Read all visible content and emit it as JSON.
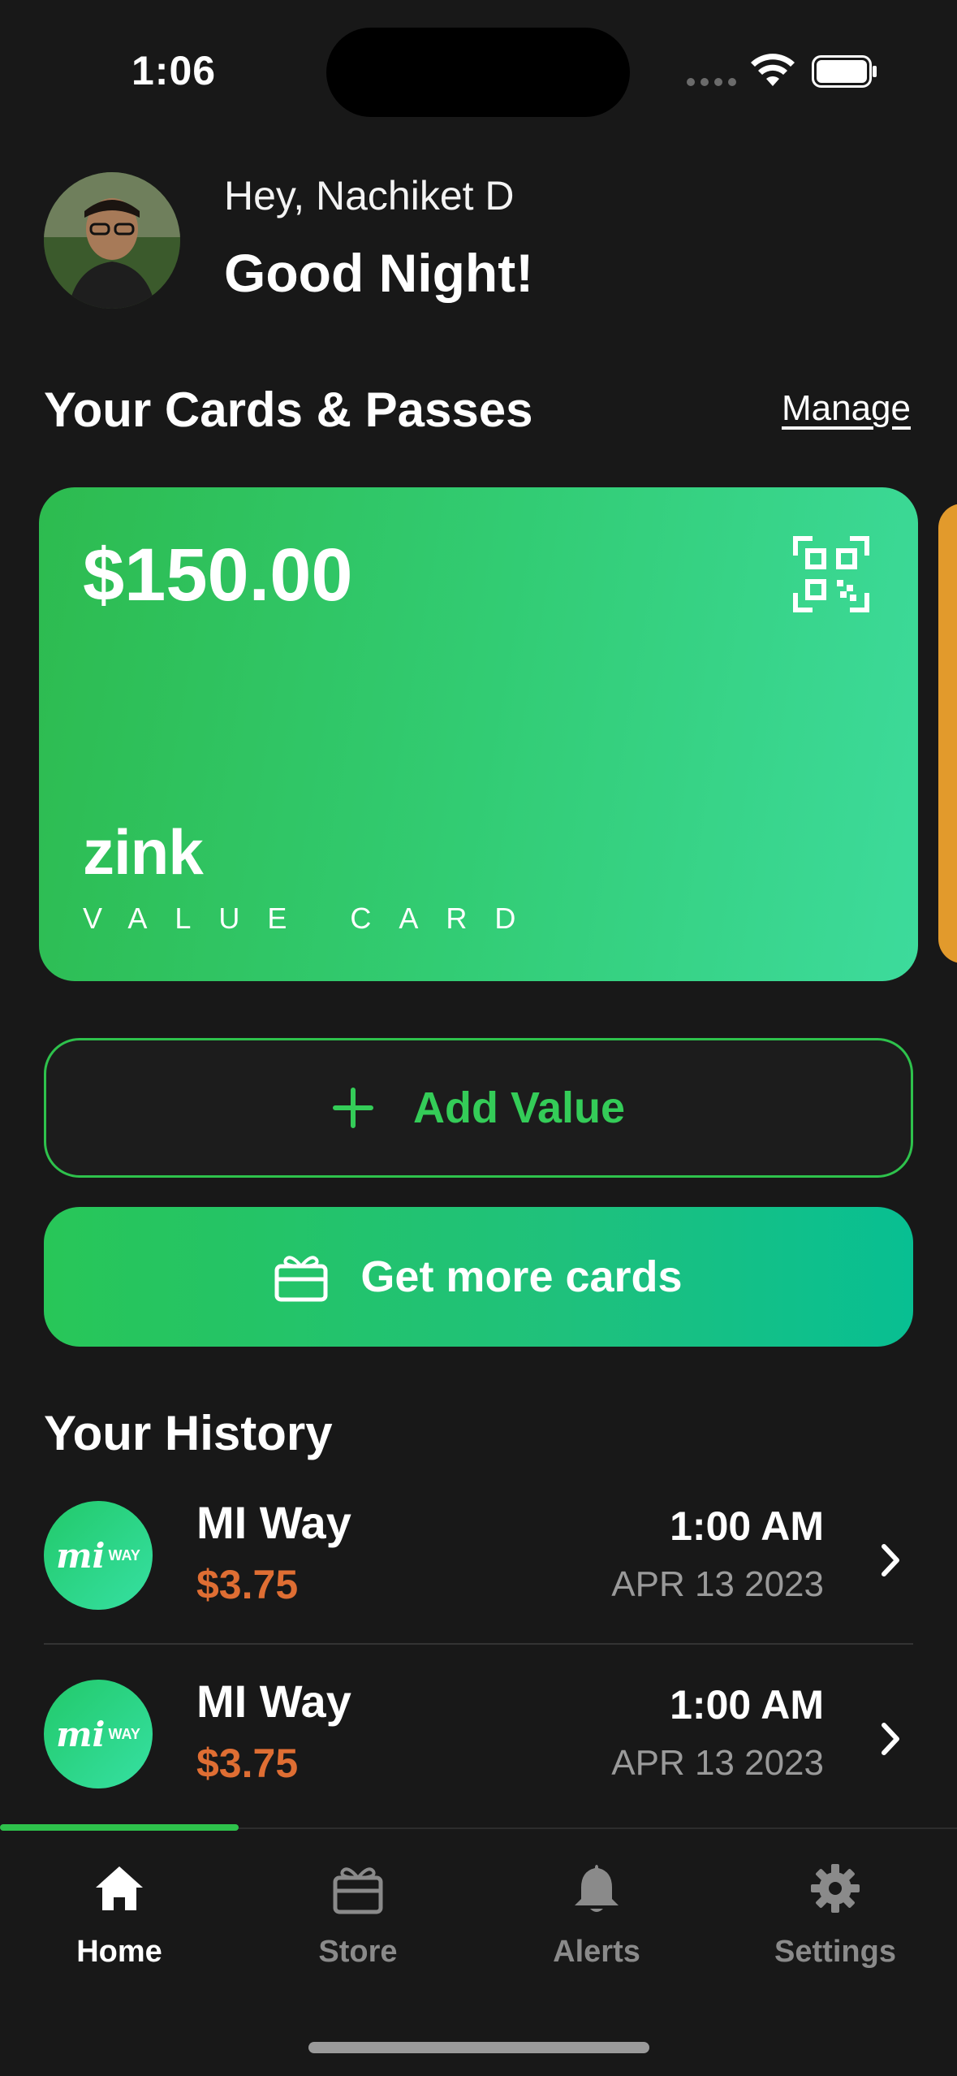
{
  "status": {
    "time": "1:06"
  },
  "user": {
    "greeting": "Hey, Nachiket D",
    "salutation": "Good Night!"
  },
  "cards_section": {
    "title": "Your Cards & Passes",
    "manage_label": "Manage"
  },
  "card": {
    "amount": "$150.00",
    "brand": "zink",
    "type_label": "VALUE CARD",
    "color_start": "#2dbb4f",
    "color_end": "#3ddb9c",
    "icon": "qr-code-icon"
  },
  "actions": {
    "add_value_label": "Add Value",
    "get_more_label": "Get more cards"
  },
  "history": {
    "title": "Your History",
    "items": [
      {
        "merchant": "MI Way",
        "amount": "$3.75",
        "time": "1:00 AM",
        "date": "APR 13 2023",
        "logo_main": "mi",
        "logo_small": "WAY"
      },
      {
        "merchant": "MI Way",
        "amount": "$3.75",
        "time": "1:00 AM",
        "date": "APR 13 2023",
        "logo_main": "mi",
        "logo_small": "WAY"
      }
    ]
  },
  "tabs": [
    {
      "label": "Home",
      "icon": "home-icon",
      "active": true
    },
    {
      "label": "Store",
      "icon": "gift-icon",
      "active": false
    },
    {
      "label": "Alerts",
      "icon": "bell-icon",
      "active": false
    },
    {
      "label": "Settings",
      "icon": "gear-icon",
      "active": false
    }
  ],
  "colors": {
    "accent": "#2ec24c",
    "price": "#df6e33",
    "background": "#181818"
  }
}
